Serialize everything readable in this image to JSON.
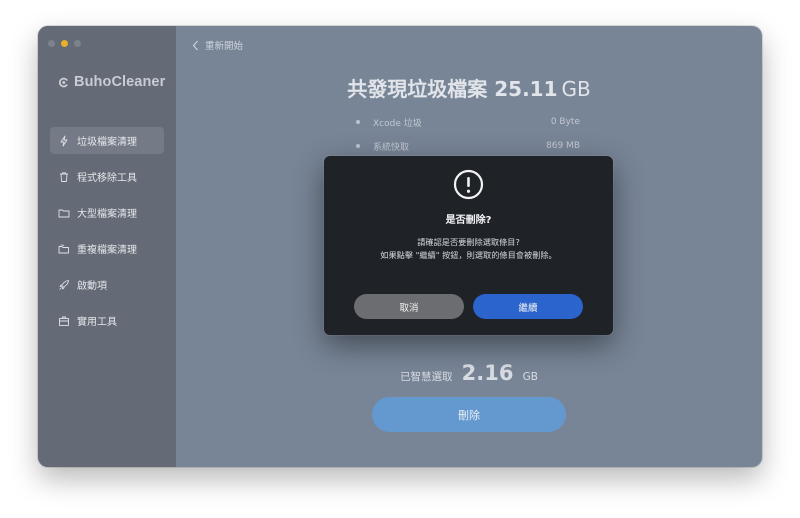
{
  "app": {
    "name": "BuhoCleaner"
  },
  "sidebar": {
    "items": [
      {
        "label": "垃圾檔案清理",
        "icon": "lightning-icon",
        "active": true
      },
      {
        "label": "程式移除工具",
        "icon": "trash-icon",
        "active": false
      },
      {
        "label": "大型檔案清理",
        "icon": "folder-icon",
        "active": false
      },
      {
        "label": "重複檔案清理",
        "icon": "duplicate-folder-icon",
        "active": false
      },
      {
        "label": "啟動項",
        "icon": "rocket-icon",
        "active": false
      },
      {
        "label": "實用工具",
        "icon": "toolbox-icon",
        "active": false
      }
    ]
  },
  "main": {
    "back_label": "重新開始",
    "headline_prefix": "共發現垃圾檔案",
    "headline_size": "25.11",
    "headline_unit": "GB",
    "items": [
      {
        "label": "Xcode 垃圾",
        "value": "0 Byte"
      },
      {
        "label": "系統快取",
        "value": "869 MB"
      }
    ],
    "selected_label": "已智慧選取",
    "selected_size": "2.16",
    "selected_unit": "GB",
    "delete_label": "刪除"
  },
  "dialog": {
    "icon": "exclamation-circle-icon",
    "title": "是否刪除?",
    "message_line1": "請確認是否要刪除選取條目?",
    "message_line2": "如果點擊 \"繼續\" 按鈕，則選取的條目會被刪除。",
    "cancel_label": "取消",
    "continue_label": "繼續"
  },
  "colors": {
    "accent": "#2a64cc",
    "delete_button": "#6499cf",
    "traffic_minimize": "#e9ae2c"
  }
}
